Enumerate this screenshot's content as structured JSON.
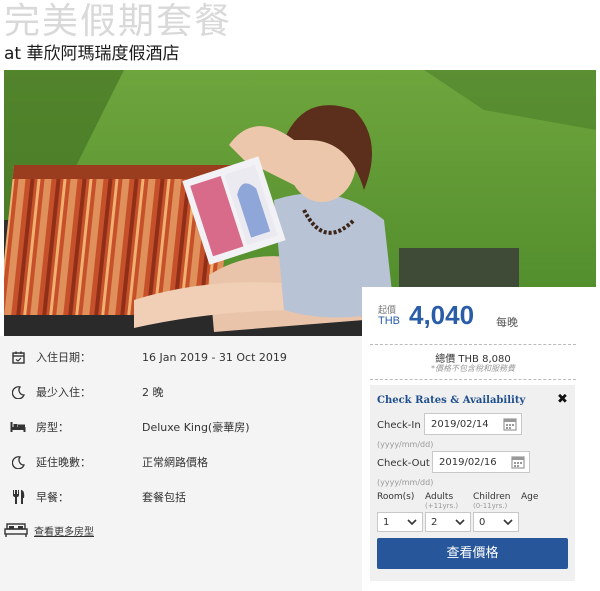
{
  "header": {
    "title": "完美假期套餐",
    "subtitle": "at 華欣阿瑪瑞度假酒店"
  },
  "details": [
    {
      "icon": "calendar-icon",
      "label": "入住日期：",
      "value": "16 Jan 2019 - 31 Oct 2019"
    },
    {
      "icon": "moon-icon",
      "label": "最少入住：",
      "value": "2 晚"
    },
    {
      "icon": "bed-icon",
      "label": "房型：",
      "value": "Deluxe King(豪華房)"
    },
    {
      "icon": "moon-icon",
      "label": "延住晚數：",
      "value": "正常網路價格"
    },
    {
      "icon": "fork-knife-icon",
      "label": "早餐：",
      "value": "套餐包括"
    }
  ],
  "more_rooms": {
    "icon": "bed-icon",
    "label": "查看更多房型"
  },
  "pricing": {
    "from_label": "起價",
    "currency": "THB",
    "amount": "4,040",
    "per_night": "每晚",
    "total_line": "總價 THB 8,080",
    "total_note": "*價格不包含稅和服務費"
  },
  "rates_form": {
    "title": "Check Rates & Availability",
    "close": "✖",
    "checkin_label": "Check-In :",
    "checkin_value": "2019/02/14",
    "checkout_label": "Check-Out :",
    "checkout_value": "2019/02/16",
    "date_hint": "(yyyy/mm/dd)",
    "rooms_label": "Room(s)",
    "adults_label": "Adults",
    "adults_sub": "(+11yrs.)",
    "children_label": "Children",
    "children_sub": "(0-11yrs.)",
    "age_label": "Age",
    "rooms_value": "1",
    "adults_value": "2",
    "children_value": "0",
    "submit_label": "查看價格"
  },
  "colors": {
    "accent": "#27579a",
    "price": "#2a5da8",
    "panel": "#f4f4f4"
  }
}
